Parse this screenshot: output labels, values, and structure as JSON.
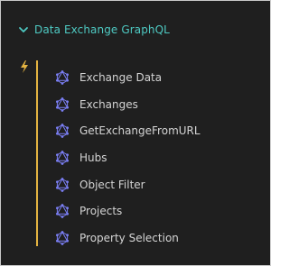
{
  "panel": {
    "title": "Data Exchange GraphQL",
    "expand_state_icon": "chevron-down-icon",
    "section_icon": "lightning-icon",
    "item_icon": "graphql-icon"
  },
  "items": [
    {
      "label": "Exchange Data"
    },
    {
      "label": "Exchanges"
    },
    {
      "label": "GetExchangeFromURL"
    },
    {
      "label": "Hubs"
    },
    {
      "label": "Object Filter"
    },
    {
      "label": "Projects"
    },
    {
      "label": "Property Selection"
    }
  ],
  "colors": {
    "background": "#1f1f1f",
    "title": "#4ec9c2",
    "item_text": "#d4d4d4",
    "icon": "#7b7ff5",
    "accent": "#e3b341"
  }
}
